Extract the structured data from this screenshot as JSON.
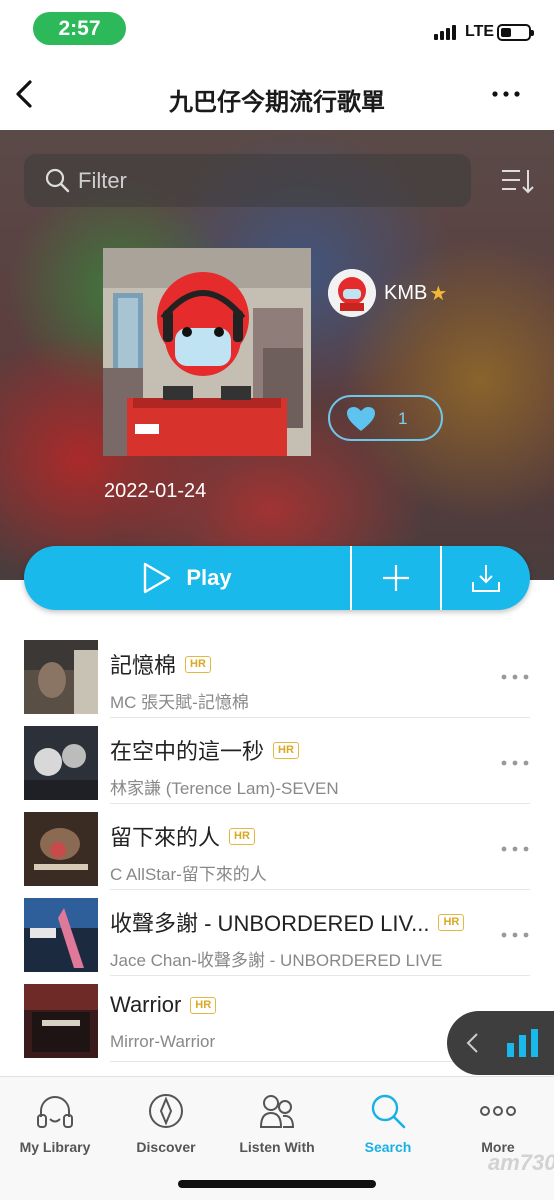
{
  "status": {
    "time": "2:57",
    "network": "LTE"
  },
  "nav": {
    "title": "九巴仔今期流行歌單"
  },
  "filter": {
    "placeholder": "Filter"
  },
  "playlist": {
    "owner": "KMB",
    "likes": "1",
    "date": "2022-01-24"
  },
  "actions": {
    "play_label": "Play"
  },
  "songs": [
    {
      "title": "記憶棉",
      "badge": "HR",
      "subtitle": "MC 張天賦-記憶棉"
    },
    {
      "title": "在空中的這一秒",
      "badge": "HR",
      "subtitle": "林家謙 (Terence Lam)-SEVEN"
    },
    {
      "title": "留下來的人",
      "badge": "HR",
      "subtitle": "C AllStar-留下來的人"
    },
    {
      "title": "收聲多謝 - UNBORDERED LIV...",
      "badge": "HR",
      "subtitle": "Jace Chan-收聲多謝 - UNBORDERED LIVE"
    },
    {
      "title": "Warrior",
      "badge": "HR",
      "subtitle": "Mirror-Warrior"
    }
  ],
  "tabs": [
    {
      "label": "My Library",
      "icon": "headphones-icon"
    },
    {
      "label": "Discover",
      "icon": "compass-icon"
    },
    {
      "label": "Listen With",
      "icon": "people-icon"
    },
    {
      "label": "Search",
      "icon": "search-icon"
    },
    {
      "label": "More",
      "icon": "more-dots-icon"
    }
  ],
  "watermark": "am730",
  "colors": {
    "accent": "#19b9ec",
    "status_pill": "#2db85a",
    "hr_badge": "#e4b840"
  }
}
